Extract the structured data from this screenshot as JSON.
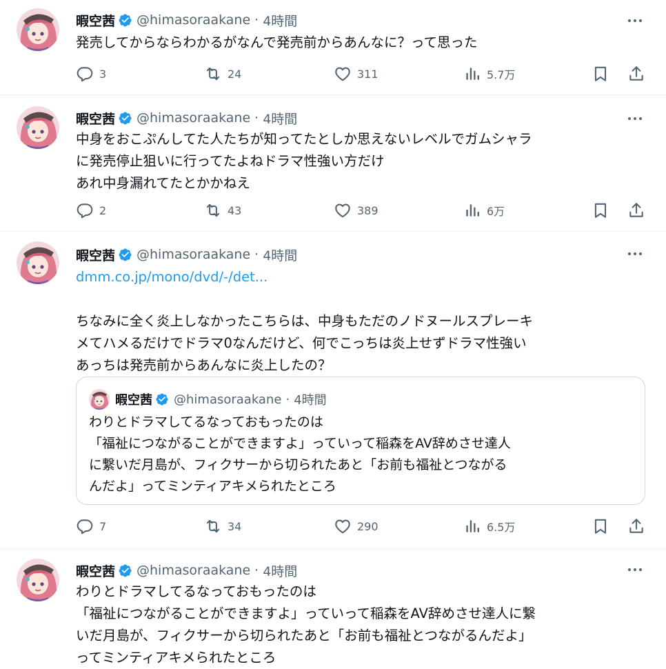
{
  "author": {
    "name": "暇空茜",
    "handle": "@himasoraakane",
    "separator": "·",
    "time": "4時間",
    "verified_icon": "verified-badge-icon",
    "accent_color": "#1d9bf0"
  },
  "tweets": [
    {
      "lines": [
        "発売してからならわかるがなんで発売前からあんなに？って思った"
      ],
      "replies": "3",
      "reposts": "24",
      "likes": "311",
      "views": "5.7万"
    },
    {
      "lines": [
        "中身をおこぷんしてた人たちが知ってたとしか思えないレベルでガムシャラ",
        "に発売停止狙いに行ってたよねドラマ性強い方だけ",
        "あれ中身漏れてたとかかねえ"
      ],
      "replies": "2",
      "reposts": "43",
      "likes": "389",
      "views": "6万"
    },
    {
      "link": "dmm.co.jp/mono/dvd/-/det...",
      "lines": [
        "ちなみに全く炎上しなかったこちらは、中身もただのノドヌールスプレーキ",
        "メてハメるだけでドラマ0なんだけど、何でこっちは炎上せずドラマ性強い",
        "あっちは発売前からあんなに炎上したの？"
      ],
      "quote": {
        "lines": [
          "わりとドラマしてるなっておもったのは",
          "「福祉につながることができますよ」っていって稲森をAV辞めさせ達人",
          "に繋いだ月島が、フィクサーから切られたあと「お前も福祉とつながる",
          "んだよ」ってミンティアキメられたところ"
        ]
      },
      "replies": "7",
      "reposts": "34",
      "likes": "290",
      "views": "6.5万"
    },
    {
      "lines": [
        "わりとドラマしてるなっておもったのは",
        "「福祉につながることができますよ」っていって稲森をAV辞めさせ達人に繋",
        "いだ月島が、フィクサーから切られたあと「お前も福祉とつながるんだよ」",
        "ってミンティアキメられたところ"
      ]
    }
  ]
}
